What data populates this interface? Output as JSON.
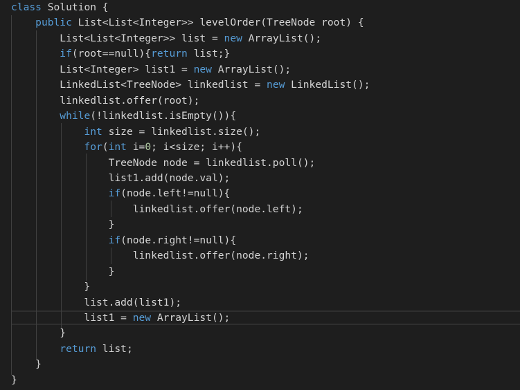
{
  "editor": {
    "theme_colors": {
      "background": "#1e1e1e",
      "default_text": "#d4d4d4",
      "keyword": "#569cd6",
      "number": "#b5cea8",
      "indent_guide": "#404040",
      "current_line_border": "#2f2f2f"
    },
    "lines": [
      [
        {
          "t": "class",
          "c": "kw"
        },
        {
          "t": " Solution {",
          "c": "txt"
        }
      ],
      [
        {
          "t": "    ",
          "c": "txt"
        },
        {
          "t": "public",
          "c": "kw"
        },
        {
          "t": " List<List<Integer>> levelOrder(TreeNode root) {",
          "c": "txt"
        }
      ],
      [
        {
          "t": "        List<List<Integer>> list = ",
          "c": "txt"
        },
        {
          "t": "new",
          "c": "kw"
        },
        {
          "t": " ArrayList();",
          "c": "txt"
        }
      ],
      [
        {
          "t": "        ",
          "c": "txt"
        },
        {
          "t": "if",
          "c": "kw"
        },
        {
          "t": "(root==null){",
          "c": "txt"
        },
        {
          "t": "return",
          "c": "kw"
        },
        {
          "t": " list;}",
          "c": "txt"
        }
      ],
      [
        {
          "t": "        List<Integer> list1 = ",
          "c": "txt"
        },
        {
          "t": "new",
          "c": "kw"
        },
        {
          "t": " ArrayList();",
          "c": "txt"
        }
      ],
      [
        {
          "t": "        LinkedList<TreeNode> linkedlist = ",
          "c": "txt"
        },
        {
          "t": "new",
          "c": "kw"
        },
        {
          "t": " LinkedList();",
          "c": "txt"
        }
      ],
      [
        {
          "t": "        linkedlist.offer(root);",
          "c": "txt"
        }
      ],
      [
        {
          "t": "        ",
          "c": "txt"
        },
        {
          "t": "while",
          "c": "kw"
        },
        {
          "t": "(!linkedlist.isEmpty()){",
          "c": "txt"
        }
      ],
      [
        {
          "t": "            ",
          "c": "txt"
        },
        {
          "t": "int",
          "c": "kw"
        },
        {
          "t": " size = linkedlist.size();",
          "c": "txt"
        }
      ],
      [
        {
          "t": "            ",
          "c": "txt"
        },
        {
          "t": "for",
          "c": "kw"
        },
        {
          "t": "(",
          "c": "txt"
        },
        {
          "t": "int",
          "c": "kw"
        },
        {
          "t": " i=",
          "c": "txt"
        },
        {
          "t": "0",
          "c": "num"
        },
        {
          "t": "; i<size; i++){",
          "c": "txt"
        }
      ],
      [
        {
          "t": "                TreeNode node = linkedlist.poll();",
          "c": "txt"
        }
      ],
      [
        {
          "t": "                list1.add(node.val);",
          "c": "txt"
        }
      ],
      [
        {
          "t": "                ",
          "c": "txt"
        },
        {
          "t": "if",
          "c": "kw"
        },
        {
          "t": "(node.left!=null){",
          "c": "txt"
        }
      ],
      [
        {
          "t": "                    linkedlist.offer(node.left);",
          "c": "txt"
        }
      ],
      [
        {
          "t": "                }",
          "c": "txt"
        }
      ],
      [
        {
          "t": "                ",
          "c": "txt"
        },
        {
          "t": "if",
          "c": "kw"
        },
        {
          "t": "(node.right!=null){",
          "c": "txt"
        }
      ],
      [
        {
          "t": "                    linkedlist.offer(node.right);",
          "c": "txt"
        }
      ],
      [
        {
          "t": "                }",
          "c": "txt"
        }
      ],
      [
        {
          "t": "            }",
          "c": "txt"
        }
      ],
      [
        {
          "t": "            list.add(list1);",
          "c": "txt"
        }
      ],
      [
        {
          "t": "            list1 = ",
          "c": "txt"
        },
        {
          "t": "new",
          "c": "kw"
        },
        {
          "t": " ArrayList();",
          "c": "txt"
        }
      ],
      [
        {
          "t": "        }",
          "c": "txt"
        }
      ],
      [
        {
          "t": "        ",
          "c": "txt"
        },
        {
          "t": "return",
          "c": "kw"
        },
        {
          "t": " list;",
          "c": "txt"
        }
      ],
      [
        {
          "t": "    }",
          "c": "txt"
        }
      ],
      [
        {
          "t": "}",
          "c": "txt"
        }
      ]
    ]
  }
}
